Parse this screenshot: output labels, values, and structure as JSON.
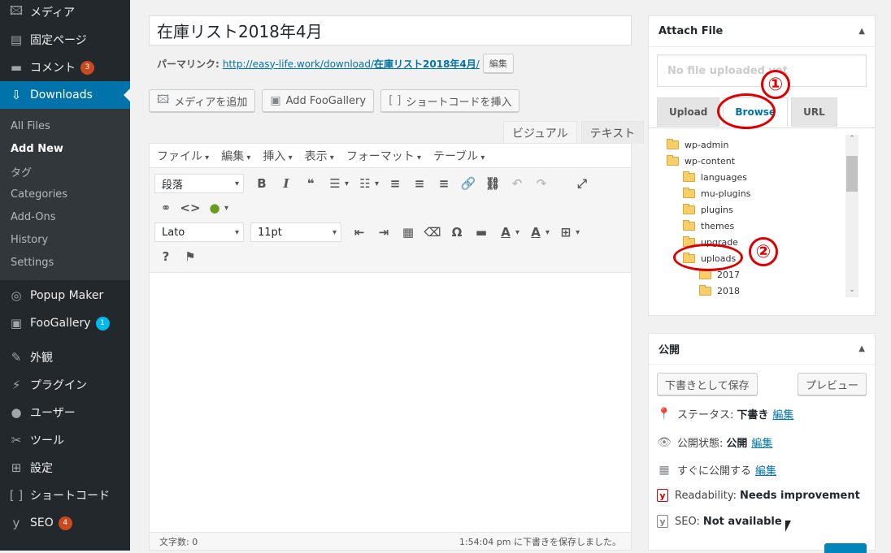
{
  "sidebar": {
    "items_top": [
      {
        "label": "メディア",
        "icon": "media-icon",
        "glyph": "🖾"
      },
      {
        "label": "固定ページ",
        "icon": "pages-icon",
        "glyph": "▤"
      },
      {
        "label": "コメント",
        "icon": "comment-icon",
        "glyph": "▬",
        "badge": "3"
      }
    ],
    "current": {
      "label": "Downloads",
      "icon": "download-icon",
      "glyph": "⇩"
    },
    "submenu": [
      "All Files",
      "Add New",
      "タグ",
      "Categories",
      "Add-Ons",
      "History",
      "Settings"
    ],
    "submenu_active": "Add New",
    "items_mid": [
      {
        "label": "Popup Maker",
        "icon": "popup-icon",
        "glyph": "◎"
      },
      {
        "label": "FooGallery",
        "icon": "gallery-icon",
        "glyph": "▣",
        "badge": "1"
      }
    ],
    "items_bottom": [
      {
        "label": "外観",
        "icon": "appearance-icon",
        "glyph": "✎"
      },
      {
        "label": "プラグイン",
        "icon": "plugin-icon",
        "glyph": "⚡"
      },
      {
        "label": "ユーザー",
        "icon": "user-icon",
        "glyph": "●"
      },
      {
        "label": "ツール",
        "icon": "tools-icon",
        "glyph": "✂"
      },
      {
        "label": "設定",
        "icon": "settings-icon",
        "glyph": "⊞"
      },
      {
        "label": "ショートコード",
        "icon": "shortcode-icon",
        "glyph": "[ ]"
      },
      {
        "label": "SEO",
        "icon": "seo-icon",
        "glyph": "y",
        "badge": "4"
      }
    ]
  },
  "title": "在庫リスト2018年4月",
  "permalink": {
    "label": "パーマリンク:",
    "url_prefix": "http://easy-life.work/download/",
    "slug": "在庫リスト2018年4月",
    "url_suffix": "/",
    "edit": "編集"
  },
  "media_buttons": [
    {
      "label": "メディアを追加",
      "icon": "add-media-icon",
      "glyph": "🖾"
    },
    {
      "label": "Add FooGallery",
      "icon": "foogallery-icon",
      "glyph": "▣"
    },
    {
      "label": "ショートコードを挿入",
      "icon": "shortcode-insert-icon",
      "glyph": "[ ]"
    }
  ],
  "editor_tabs": [
    "ビジュアル",
    "テキスト"
  ],
  "editor_menu": [
    "ファイル",
    "編集",
    "挿入",
    "表示",
    "フォーマット",
    "テーブル"
  ],
  "toolbar": {
    "format_select": "段落",
    "font_select": "Lato",
    "size_select": "11pt"
  },
  "statusbar": {
    "word_count": "文字数: 0",
    "saved": "1:54:04 pm に下書きを保存しました。"
  },
  "attach": {
    "title": "Attach File",
    "placeholder": "No file uploaded yet",
    "tabs": [
      "Upload",
      "Browse",
      "URL"
    ],
    "active_tab": "Browse",
    "tree": [
      "wp-admin",
      "wp-content",
      "languages",
      "mu-plugins",
      "plugins",
      "themes",
      "upgrade",
      "uploads",
      "2017",
      "2018"
    ],
    "annotations": [
      "①",
      "②"
    ]
  },
  "publish": {
    "title": "公開",
    "save_draft": "下書きとして保存",
    "preview": "プレビュー",
    "status_label": "ステータス:",
    "status_value": "下書き",
    "visibility_label": "公開状態:",
    "visibility_value": "公開",
    "schedule_label": "すぐに公開する",
    "edit": "編集",
    "readability_label": "Readability:",
    "readability_value": "Needs improvement",
    "seo_label": "SEO:",
    "seo_value": "Not available"
  },
  "colors": {
    "admin_blue": "#0073aa",
    "sidebar": "#23282d",
    "badge": "#ca4a1f",
    "annotation_red": "#dd0000"
  }
}
